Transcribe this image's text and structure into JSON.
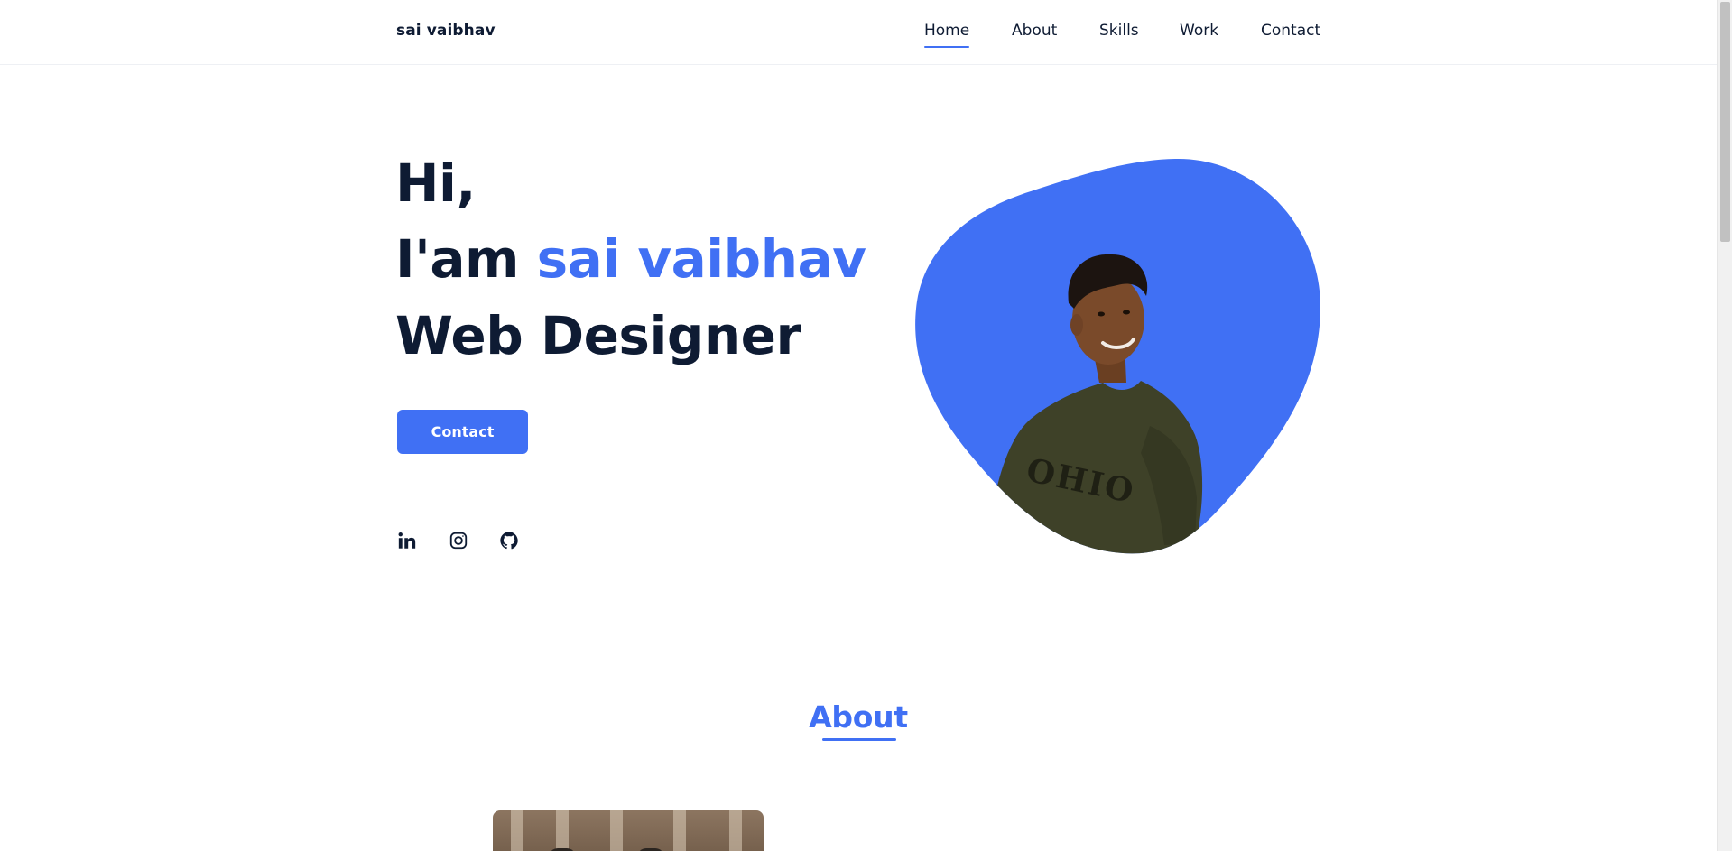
{
  "header": {
    "logo": "sai vaibhav",
    "nav": [
      {
        "label": "Home",
        "active": true
      },
      {
        "label": "About",
        "active": false
      },
      {
        "label": "Skills",
        "active": false
      },
      {
        "label": "Work",
        "active": false
      },
      {
        "label": "Contact",
        "active": false
      }
    ]
  },
  "hero": {
    "line1": "Hi,",
    "line2_prefix": "I'am",
    "name": "sai vaibhav",
    "role": "Web Designer",
    "button": "Contact",
    "social": [
      {
        "icon": "linkedin-icon"
      },
      {
        "icon": "instagram-icon"
      },
      {
        "icon": "github-icon"
      }
    ],
    "shirt_text": "OHIO"
  },
  "about": {
    "title": "About"
  },
  "colors": {
    "accent": "#4070f4",
    "text": "#0e1b33",
    "background": "#ffffff"
  }
}
